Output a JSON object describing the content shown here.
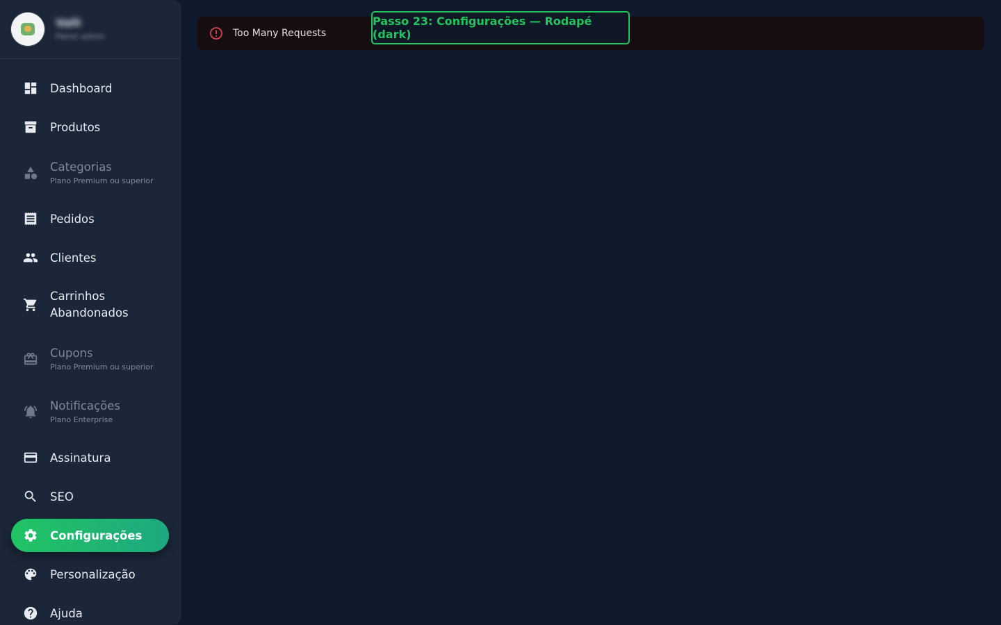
{
  "profile": {
    "name": "Valli",
    "subtitle": "Painel admin"
  },
  "nav": {
    "items": [
      {
        "label": "Dashboard",
        "icon": "dashboard-icon"
      },
      {
        "label": "Produtos",
        "icon": "archive-icon"
      },
      {
        "label": "Categorias",
        "sub": "Plano Premium ou superior",
        "icon": "category-icon",
        "disabled": true
      },
      {
        "label": "Pedidos",
        "icon": "receipt-icon"
      },
      {
        "label": "Clientes",
        "icon": "people-icon"
      },
      {
        "label": "Carrinhos Abandonados",
        "line1": "Carrinhos",
        "line2": "Abandonados",
        "icon": "cart-icon"
      },
      {
        "label": "Cupons",
        "sub": "Plano Premium ou superior",
        "icon": "coupon-icon",
        "disabled": true
      },
      {
        "label": "Notificações",
        "sub": "Plano Enterprise",
        "icon": "bell-icon",
        "disabled": true
      },
      {
        "label": "Assinatura",
        "icon": "credit-card-icon"
      },
      {
        "label": "SEO",
        "icon": "search-icon"
      },
      {
        "label": "Configurações",
        "icon": "gear-icon",
        "active": true
      },
      {
        "label": "Personalização",
        "icon": "palette-icon"
      },
      {
        "label": "Ajuda",
        "icon": "help-icon"
      }
    ]
  },
  "alert": {
    "message": "Too Many Requests",
    "icon": "error-circle-icon",
    "color": "#e0454d"
  },
  "step_tag": {
    "label": "Passo 23: Configurações — Rodapé (dark)",
    "color": "#22c55e"
  },
  "colors": {
    "background": "#111a2c",
    "sidebar": "#1b2638",
    "accent": "#20c463"
  }
}
